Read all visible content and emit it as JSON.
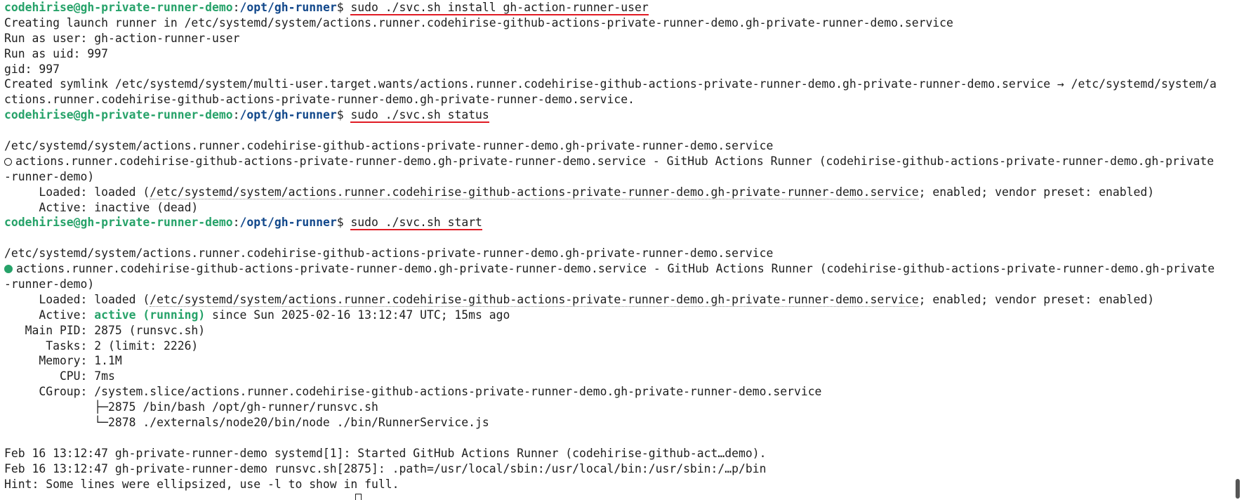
{
  "prompt": {
    "user_host": "codehirise@gh-private-runner-demo",
    "colon": ":",
    "path": "/opt/gh-runner",
    "dollar": "$ "
  },
  "commands": {
    "install": "sudo ./svc.sh install gh-action-runner-user",
    "status": "sudo ./svc.sh status",
    "start": "sudo ./svc.sh start"
  },
  "install_output": [
    "Creating launch runner in /etc/systemd/system/actions.runner.codehirise-github-actions-private-runner-demo.gh-private-runner-demo.service",
    "Run as user: gh-action-runner-user",
    "Run as uid: 997",
    "gid: 997",
    "Created symlink /etc/systemd/system/multi-user.target.wants/actions.runner.codehirise-github-actions-private-runner-demo.gh-private-runner-demo.service → /etc/systemd/system/a",
    "ctions.runner.codehirise-github-actions-private-runner-demo.gh-private-runner-demo.service."
  ],
  "status_output": {
    "unit_path": "/etc/systemd/system/actions.runner.codehirise-github-actions-private-runner-demo.gh-private-runner-demo.service",
    "unit_line_1": "actions.runner.codehirise-github-actions-private-runner-demo.gh-private-runner-demo.service - GitHub Actions Runner (codehirise-github-actions-private-runner-demo.gh-private",
    "unit_line_2": "-runner-demo)",
    "loaded_prefix": "     Loaded: loaded (",
    "loaded_path": "/etc/systemd/system/actions.runner.codehirise-github-actions-private-runner-demo.gh-private-runner-demo.service",
    "loaded_suffix": "; enabled; vendor preset: enabled)",
    "active": "     Active: inactive (dead)"
  },
  "start_output": {
    "unit_path": "/etc/systemd/system/actions.runner.codehirise-github-actions-private-runner-demo.gh-private-runner-demo.service",
    "unit_line_1": "actions.runner.codehirise-github-actions-private-runner-demo.gh-private-runner-demo.service - GitHub Actions Runner (codehirise-github-actions-private-runner-demo.gh-private",
    "unit_line_2": "-runner-demo)",
    "loaded_prefix": "     Loaded: loaded (",
    "loaded_path": "/etc/systemd/system/actions.runner.codehirise-github-actions-private-runner-demo.gh-private-runner-demo.service",
    "loaded_suffix": "; enabled; vendor preset: enabled)",
    "active_prefix": "     Active: ",
    "active_state": "active (running)",
    "active_suffix": " since Sun 2025-02-16 13:12:47 UTC; 15ms ago",
    "main_pid": "   Main PID: 2875 (runsvc.sh)",
    "tasks": "      Tasks: 2 (limit: 2226)",
    "memory": "     Memory: 1.1M",
    "cpu": "        CPU: 7ms",
    "cgroup": "     CGroup: /system.slice/actions.runner.codehirise-github-actions-private-runner-demo.gh-private-runner-demo.service",
    "cgroup_child_1": "             ├─2875 /bin/bash /opt/gh-runner/runsvc.sh",
    "cgroup_child_2": "             └─2878 ./externals/node20/bin/node ./bin/RunnerService.js",
    "log_1": "Feb 16 13:12:47 gh-private-runner-demo systemd[1]: Started GitHub Actions Runner (codehirise-github-act…demo).",
    "log_2": "Feb 16 13:12:47 gh-private-runner-demo runsvc.sh[2875]: .path=/usr/local/sbin:/usr/local/bin:/usr/sbin:/…p/bin",
    "hint": "Hint: Some lines were ellipsized, use -l to show in full."
  },
  "colors": {
    "prompt_user": "#26a269",
    "prompt_path": "#12488b",
    "underline": "#e01b24",
    "active": "#26a269"
  }
}
